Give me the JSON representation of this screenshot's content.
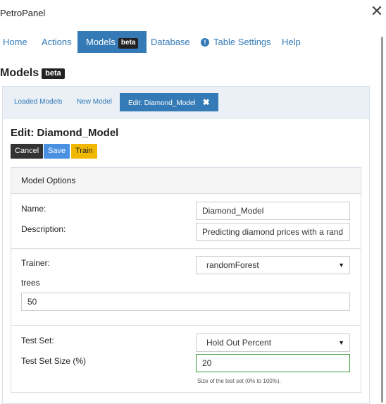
{
  "window": {
    "title": "PetroPanel"
  },
  "nav": {
    "home": "Home",
    "actions": "Actions",
    "models": "Models",
    "models_badge": "beta",
    "database": "Database",
    "table_settings": "Table Settings",
    "help": "Help"
  },
  "page": {
    "title": "Models",
    "badge": "beta"
  },
  "tabs": {
    "loaded": "Loaded Models",
    "new": "New Model",
    "edit": "Edit: Diamond_Model",
    "close_glyph": "✖"
  },
  "editor": {
    "title": "Edit: Diamond_Model",
    "cancel": "Cancel",
    "save": "Save",
    "train": "Train"
  },
  "options": {
    "heading": "Model Options",
    "name_label": "Name:",
    "name_value": "Diamond_Model",
    "description_label": "Description:",
    "description_value": "Predicting diamond prices with a rand",
    "trainer_label": "Trainer:",
    "trainer_value": "randomForest",
    "trees_label": "trees",
    "trees_value": "50",
    "testset_label": "Test Set:",
    "testset_value": "Hold Out Percent",
    "testsize_label": "Test Set Size (%)",
    "testsize_value": "20",
    "testsize_help": "Size of the test set (0% to 100%)."
  },
  "colors": {
    "accent": "#337ab7",
    "train": "#f0b800",
    "valid": "#3c9a3c"
  }
}
